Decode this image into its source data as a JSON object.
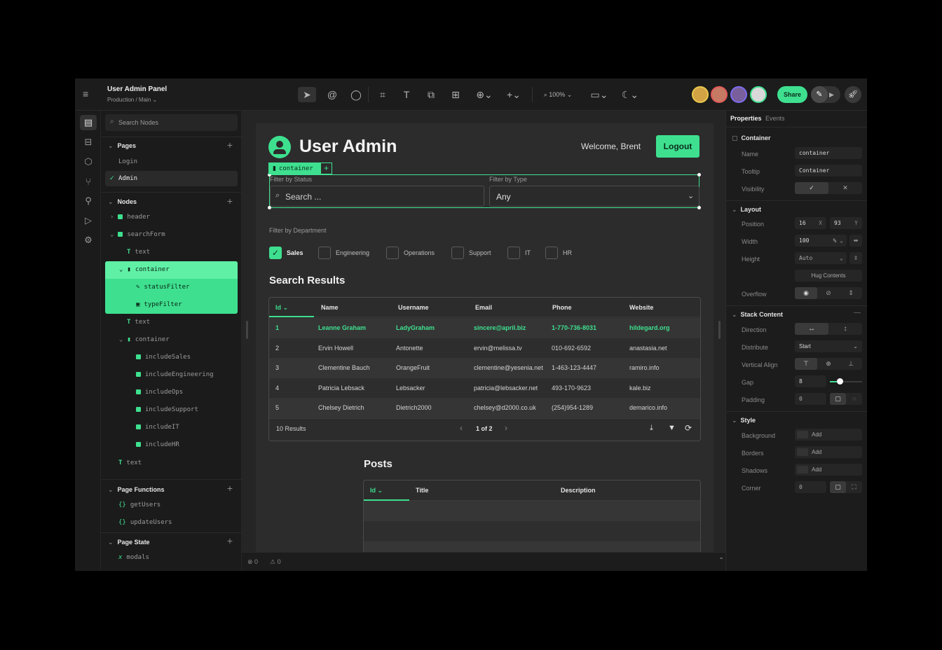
{
  "app": {
    "title": "User Admin Panel",
    "env": "Production",
    "branch": "Main"
  },
  "toolbar": {
    "zoom": "100%",
    "share": "Share"
  },
  "left": {
    "search_placeholder": "Search Nodes",
    "pages_label": "Pages",
    "pages": [
      "Login",
      "Admin"
    ],
    "nodes_label": "Nodes",
    "nodes": [
      "header",
      "searchForm",
      "text",
      "container",
      "statusFilter",
      "typeFilter",
      "text",
      "container",
      "includeSales",
      "includeEngineering",
      "includeOps",
      "includeSupport",
      "includeIT",
      "includeHR",
      "text"
    ],
    "functions_label": "Page Functions",
    "functions": [
      "getUsers",
      "updateUsers"
    ],
    "state_label": "Page State",
    "state": [
      "modals"
    ]
  },
  "page": {
    "title": "User Admin",
    "welcome": "Welcome, Brent",
    "logout": "Logout",
    "container_tag": "container",
    "filter_status_label": "Filter by Status",
    "search_placeholder": "Search ...",
    "filter_type_label": "Filter by Type",
    "type_value": "Any",
    "dept_label": "Filter by Department",
    "departments": [
      "Sales",
      "Engineering",
      "Operations",
      "Support",
      "IT",
      "HR"
    ],
    "results_title": "Search Results",
    "columns": [
      "Id",
      "Name",
      "Username",
      "Email",
      "Phone",
      "Website"
    ],
    "rows": [
      [
        "1",
        "Leanne Graham",
        "LadyGraham",
        "sincere@april.biz",
        "1-770-736-8031",
        "hildegard.org"
      ],
      [
        "2",
        "Ervin Howell",
        "Antonette",
        "ervin@melissa.tv",
        "010-692-6592",
        "anastasia.net"
      ],
      [
        "3",
        "Clementine Bauch",
        "OrangeFruit",
        "clementine@yesenia.net",
        "1-463-123-4447",
        "ramiro.info"
      ],
      [
        "4",
        "Patricia Lebsack",
        "Lebsacker",
        "patricia@lebsacker.net",
        "493-170-9623",
        "kale.biz"
      ],
      [
        "5",
        "Chelsey Dietrich",
        "Dietrich2000",
        "chelsey@d2000.co.uk",
        "(254)954-1289",
        "demarico.info"
      ]
    ],
    "result_count": "10 Results",
    "pagination": "1 of 2",
    "posts_title": "Posts",
    "posts_columns": [
      "Id",
      "Title",
      "Description"
    ]
  },
  "status": {
    "errors": "0",
    "warnings": "0"
  },
  "right": {
    "tab_properties": "Properties",
    "tab_events": "Events",
    "container_section": "Container",
    "name_label": "Name",
    "name_value": "container",
    "tooltip_label": "Tooltip",
    "tooltip_value": "Container",
    "visibility_label": "Visibility",
    "layout_section": "Layout",
    "position_label": "Position",
    "pos_x": "16",
    "pos_x_unit": "X",
    "pos_y": "93",
    "pos_y_unit": "Y",
    "width_label": "Width",
    "width_value": "100",
    "width_unit": "%",
    "height_label": "Height",
    "height_value": "Auto",
    "hug": "Hug Contents",
    "overflow_label": "Overflow",
    "stack_section": "Stack Content",
    "direction_label": "Direction",
    "distribute_label": "Distribute",
    "distribute_value": "Start",
    "valign_label": "Vertical Align",
    "gap_label": "Gap",
    "gap_value": "8",
    "padding_label": "Padding",
    "padding_value": "0",
    "style_section": "Style",
    "background_label": "Background",
    "borders_label": "Borders",
    "shadows_label": "Shadows",
    "add": "Add",
    "corner_label": "Corner",
    "corner_value": "0"
  },
  "colors": {
    "accent": "#3ee08f",
    "bg": "#1b1b1b"
  }
}
